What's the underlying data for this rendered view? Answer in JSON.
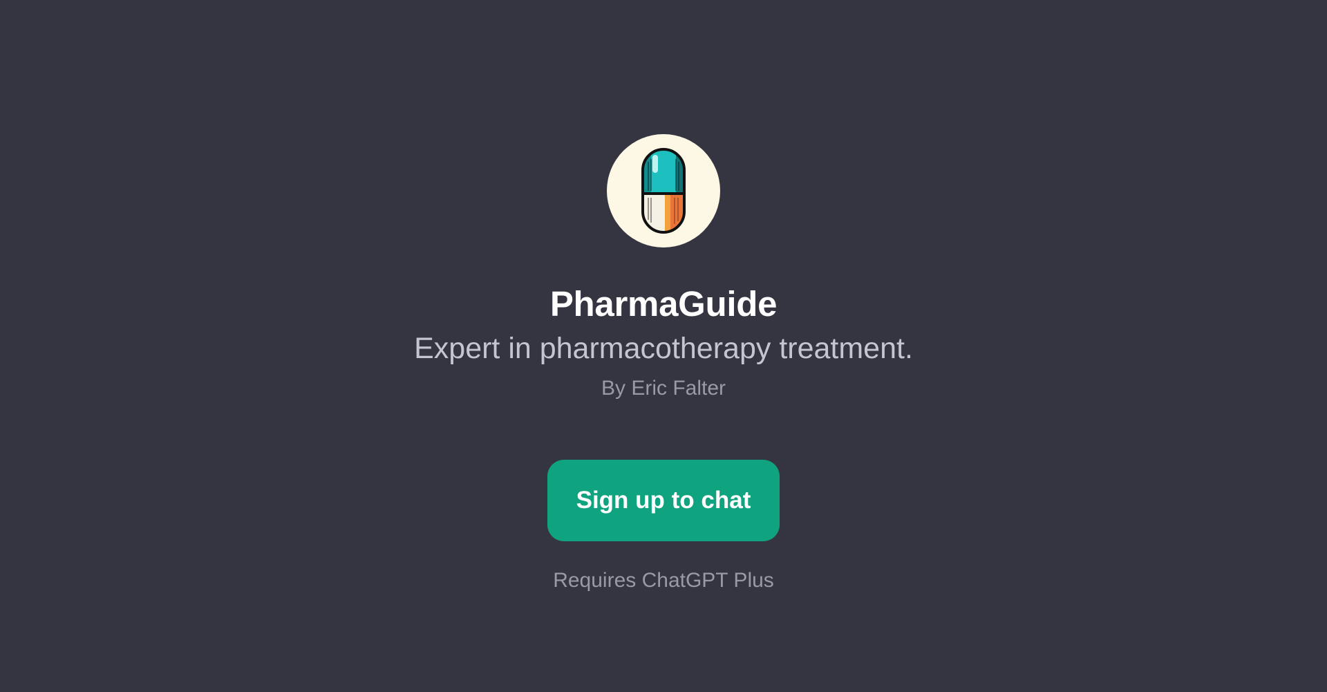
{
  "gpt": {
    "avatar_icon": "capsule-pill-icon",
    "name": "PharmaGuide",
    "description": "Expert in pharmacotherapy treatment.",
    "author": "By Eric Falter"
  },
  "actions": {
    "signup_label": "Sign up to chat",
    "requirement_note": "Requires ChatGPT Plus"
  },
  "colors": {
    "background": "#343541",
    "accent": "#10a37f",
    "avatar_bg": "#fdf8e6",
    "capsule_teal": "#1ebfbf",
    "capsule_orange": "#e8763a"
  }
}
